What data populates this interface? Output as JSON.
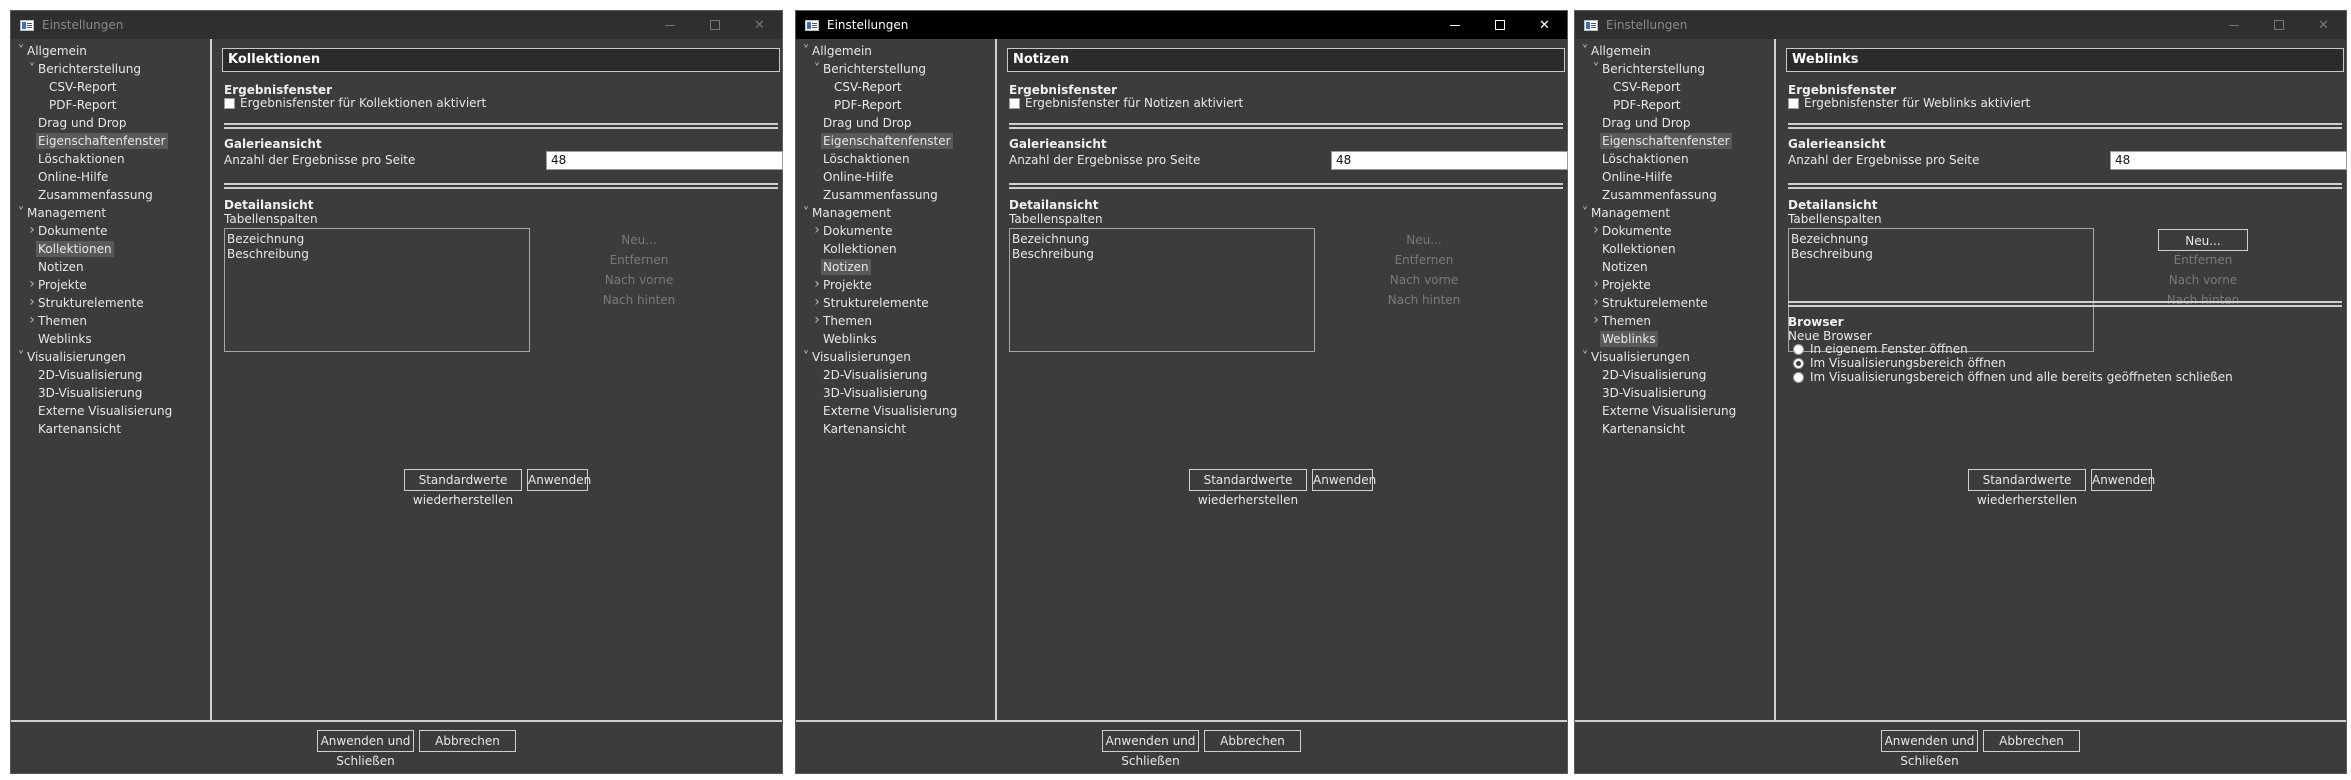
{
  "windows": [
    {
      "title": "Einstellungen",
      "active": false,
      "page": "Kollektionen",
      "selected": "Kollektionen",
      "result_window": {
        "heading": "Ergebnisfenster",
        "checkbox_label": "Ergebnisfenster für Kollektionen aktiviert",
        "checked": false
      },
      "gallery": {
        "heading": "Galerieansicht",
        "label": "Anzahl der Ergebnisse pro Seite",
        "value": "48"
      },
      "detail": {
        "heading": "Detailansicht",
        "columns_label": "Tabellenspalten",
        "columns": [
          "Bezeichnung",
          "Beschreibung"
        ]
      },
      "side_buttons": {
        "new": "Neu...",
        "remove": "Entfernen",
        "forward": "Nach vorne",
        "back": "Nach hinten",
        "new_enabled": false
      },
      "browser": null,
      "restore_label": "Standardwerte wiederherstellen",
      "apply_label": "Anwenden",
      "apply_close_label": "Anwenden und Schließen",
      "cancel_label": "Abbrechen"
    },
    {
      "title": "Einstellungen",
      "active": true,
      "page": "Notizen",
      "selected": "Notizen",
      "result_window": {
        "heading": "Ergebnisfenster",
        "checkbox_label": "Ergebnisfenster für Notizen aktiviert",
        "checked": false
      },
      "gallery": {
        "heading": "Galerieansicht",
        "label": "Anzahl der Ergebnisse pro Seite",
        "value": "48"
      },
      "detail": {
        "heading": "Detailansicht",
        "columns_label": "Tabellenspalten",
        "columns": [
          "Bezeichnung",
          "Beschreibung"
        ]
      },
      "side_buttons": {
        "new": "Neu...",
        "remove": "Entfernen",
        "forward": "Nach vorne",
        "back": "Nach hinten",
        "new_enabled": false
      },
      "browser": null,
      "restore_label": "Standardwerte wiederherstellen",
      "apply_label": "Anwenden",
      "apply_close_label": "Anwenden und Schließen",
      "cancel_label": "Abbrechen"
    },
    {
      "title": "Einstellungen",
      "active": false,
      "page": "Weblinks",
      "selected": "Weblinks",
      "result_window": {
        "heading": "Ergebnisfenster",
        "checkbox_label": "Ergebnisfenster für Weblinks aktiviert",
        "checked": false
      },
      "gallery": {
        "heading": "Galerieansicht",
        "label": "Anzahl der Ergebnisse pro Seite",
        "value": "48"
      },
      "detail": {
        "heading": "Detailansicht",
        "columns_label": "Tabellenspalten",
        "columns": [
          "Bezeichnung",
          "Beschreibung"
        ]
      },
      "side_buttons": {
        "new": "Neu...",
        "remove": "Entfernen",
        "forward": "Nach vorne",
        "back": "Nach hinten",
        "new_enabled": true
      },
      "browser": {
        "heading": "Browser",
        "label": "Neue Browser",
        "options": [
          {
            "label": "In eigenem Fenster öffnen",
            "checked": false
          },
          {
            "label": "Im Visualisierungsbereich öffnen",
            "checked": true
          },
          {
            "label": "Im Visualisierungsbereich öffnen und alle bereits geöffneten schließen",
            "checked": false
          }
        ]
      },
      "restore_label": "Standardwerte wiederherstellen",
      "apply_label": "Anwenden",
      "apply_close_label": "Anwenden und Schließen",
      "cancel_label": "Abbrechen"
    }
  ],
  "tree": [
    {
      "label": "Allgemein",
      "level": 0,
      "twisty": "open"
    },
    {
      "label": "Berichterstellung",
      "level": 1,
      "twisty": "open"
    },
    {
      "label": "CSV-Report",
      "level": 2,
      "twisty": "none"
    },
    {
      "label": "PDF-Report",
      "level": 2,
      "twisty": "none"
    },
    {
      "label": "Drag und Drop",
      "level": 1,
      "twisty": "none"
    },
    {
      "label": "Eigenschaftenfenster",
      "level": 1,
      "twisty": "none",
      "highlight": true
    },
    {
      "label": "Löschaktionen",
      "level": 1,
      "twisty": "none"
    },
    {
      "label": "Online-Hilfe",
      "level": 1,
      "twisty": "none"
    },
    {
      "label": "Zusammenfassung",
      "level": 1,
      "twisty": "none"
    },
    {
      "label": "Management",
      "level": 0,
      "twisty": "open"
    },
    {
      "label": "Dokumente",
      "level": 1,
      "twisty": "closed"
    },
    {
      "label": "Kollektionen",
      "level": 1,
      "twisty": "none"
    },
    {
      "label": "Notizen",
      "level": 1,
      "twisty": "none"
    },
    {
      "label": "Projekte",
      "level": 1,
      "twisty": "closed"
    },
    {
      "label": "Strukturelemente",
      "level": 1,
      "twisty": "closed"
    },
    {
      "label": "Themen",
      "level": 1,
      "twisty": "closed"
    },
    {
      "label": "Weblinks",
      "level": 1,
      "twisty": "none"
    },
    {
      "label": "Visualisierungen",
      "level": 0,
      "twisty": "open"
    },
    {
      "label": "2D-Visualisierung",
      "level": 1,
      "twisty": "none"
    },
    {
      "label": "3D-Visualisierung",
      "level": 1,
      "twisty": "none"
    },
    {
      "label": "Externe Visualisierung",
      "level": 1,
      "twisty": "none"
    },
    {
      "label": "Kartenansicht",
      "level": 1,
      "twisty": "none"
    }
  ]
}
